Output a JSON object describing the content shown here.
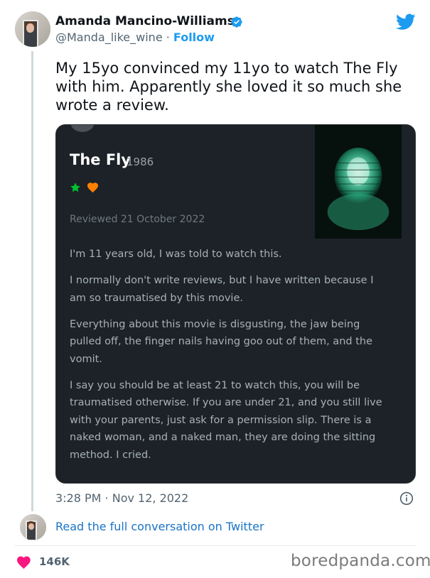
{
  "tweet": {
    "author_name": "Amanda Mancino-Williams",
    "handle": "@Manda_like_wine",
    "separator": " · ",
    "follow_label": "Follow",
    "text": "My 15yo convinced my 11yo to watch The Fly with him. Apparently she loved it so much she wrote a review.",
    "timestamp": "3:28 PM · Nov 12, 2022",
    "read_link": "Read the full conversation on Twitter",
    "like_count": "146K"
  },
  "review": {
    "title": "The Fly",
    "year": "1986",
    "reviewed_date": "Reviewed 21 October 2022",
    "paragraphs": [
      "I'm 11 years old, I was told to watch this.",
      "I normally don't write reviews, but I have written because I am so traumatised by this movie.",
      "Everything about this movie is disgusting, the jaw being pulled off, the finger nails having goo out of them, and the vomit.",
      "I say you should be at least 21 to watch this, you will be traumatised otherwise. If you are under 21, and you still live with your parents, just ask for a permission slip. There is a naked woman, and a naked man, they are doing the sitting method. I cried."
    ],
    "rating_star_color": "#00c030",
    "like_heart_color": "#ff8000"
  },
  "watermark": "boredpanda.com",
  "colors": {
    "accent": "#1d9bf0",
    "like": "#f91880",
    "card_bg": "#1c2228"
  }
}
